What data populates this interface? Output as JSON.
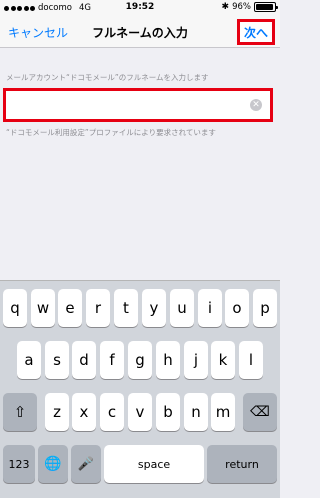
{
  "status_bar": {
    "carrier": "docomo",
    "network": "4G",
    "time": "19:52",
    "battery": "96%",
    "battery_level": 0.96
  },
  "nav": {
    "cancel_label": "キャンセル",
    "title": "フルネームの入力",
    "next_label": "次へ"
  },
  "form": {
    "caption": "メールアカウント“ドコモメール”のフルネームを入力します",
    "input_value": "",
    "footer": "“ドコモメール利用設定”プロファイルにより要求されています"
  },
  "keyboard": {
    "row1": [
      "q",
      "w",
      "e",
      "r",
      "t",
      "y",
      "u",
      "i",
      "o",
      "p"
    ],
    "row2": [
      "a",
      "s",
      "d",
      "f",
      "g",
      "h",
      "j",
      "k",
      "l"
    ],
    "row3": [
      "z",
      "x",
      "c",
      "v",
      "b",
      "n",
      "m"
    ],
    "numbers_label": "123",
    "space_label": "space",
    "return_label": "return"
  },
  "colors": {
    "accent": "#007aff",
    "highlight": "#e60012"
  }
}
